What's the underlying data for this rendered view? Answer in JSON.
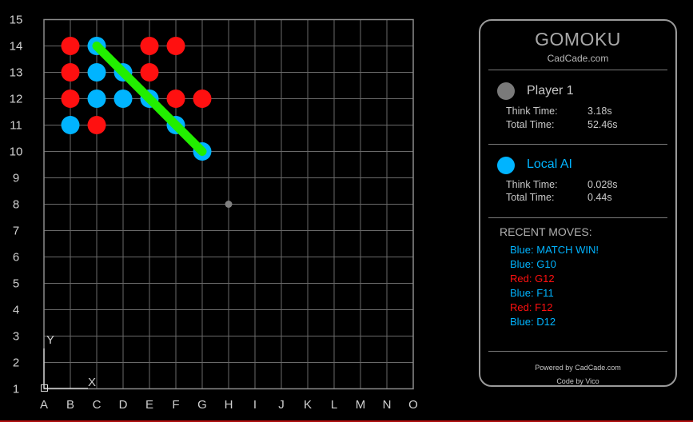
{
  "board": {
    "columns": [
      "A",
      "B",
      "C",
      "D",
      "E",
      "F",
      "G",
      "H",
      "I",
      "J",
      "K",
      "L",
      "M",
      "N",
      "O"
    ],
    "rows": [
      "15",
      "14",
      "13",
      "12",
      "11",
      "10",
      "9",
      "8",
      "7",
      "6",
      "5",
      "4",
      "3",
      "2",
      "1"
    ],
    "colors": {
      "red": "#ff1010",
      "blue": "#00b4ff",
      "win_line": "#22ee00",
      "center_dot": "#808080"
    },
    "red_stones": [
      {
        "col": "B",
        "row": 14
      },
      {
        "col": "E",
        "row": 14
      },
      {
        "col": "F",
        "row": 14
      },
      {
        "col": "B",
        "row": 13
      },
      {
        "col": "E",
        "row": 13
      },
      {
        "col": "B",
        "row": 12
      },
      {
        "col": "F",
        "row": 12
      },
      {
        "col": "G",
        "row": 12
      },
      {
        "col": "C",
        "row": 11
      }
    ],
    "blue_stones": [
      {
        "col": "C",
        "row": 14
      },
      {
        "col": "C",
        "row": 13
      },
      {
        "col": "D",
        "row": 13
      },
      {
        "col": "C",
        "row": 12
      },
      {
        "col": "D",
        "row": 12
      },
      {
        "col": "E",
        "row": 12
      },
      {
        "col": "B",
        "row": 11
      },
      {
        "col": "F",
        "row": 11
      },
      {
        "col": "G",
        "row": 10
      }
    ],
    "win_line": {
      "from": {
        "col": "C",
        "row": 14
      },
      "to": {
        "col": "G",
        "row": 10
      }
    },
    "center_dot": {
      "col": "H",
      "row": 8
    },
    "axis_icon": {
      "x_label": "X",
      "y_label": "Y"
    }
  },
  "panel": {
    "title": "GOMOKU",
    "subtitle": "CadCade.com",
    "player1": {
      "name": "Player 1",
      "color": "#7a7a7a",
      "think_label": "Think Time:",
      "think_value": "3.18s",
      "total_label": "Total Time:",
      "total_value": "52.46s"
    },
    "player2": {
      "name": "Local AI",
      "color": "#00b4ff",
      "think_label": "Think Time:",
      "think_value": "0.028s",
      "total_label": "Total Time:",
      "total_value": "0.44s"
    },
    "recent_title": "RECENT MOVES:",
    "moves": [
      {
        "text": "Blue: MATCH WIN!",
        "color": "#00b4ff"
      },
      {
        "text": "Blue: G10",
        "color": "#00b4ff"
      },
      {
        "text": "Red: G12",
        "color": "#ff1010"
      },
      {
        "text": "Blue: F11",
        "color": "#00b4ff"
      },
      {
        "text": "Red: F12",
        "color": "#ff1010"
      },
      {
        "text": "Blue: D12",
        "color": "#00b4ff"
      }
    ],
    "footer1": "Powered by CadCade.com",
    "footer2": "Code by Vico"
  }
}
